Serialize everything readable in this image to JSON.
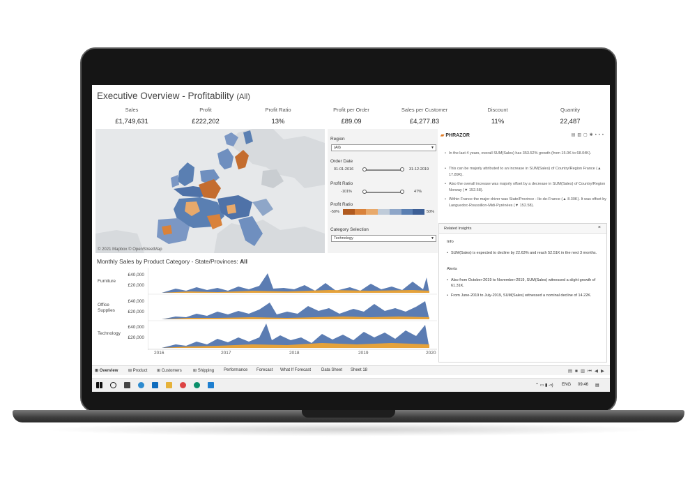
{
  "dashboard": {
    "title": "Executive Overview - Profitability",
    "title_scope": "(All)",
    "kpis": [
      {
        "label": "Sales",
        "value": "£1,749,631"
      },
      {
        "label": "Profit",
        "value": "£222,202"
      },
      {
        "label": "Profit Ratio",
        "value": "13%"
      },
      {
        "label": "Profit per Order",
        "value": "£89.09"
      },
      {
        "label": "Sales per Customer",
        "value": "£4,277.83"
      },
      {
        "label": "Discount",
        "value": "11%"
      },
      {
        "label": "Quantity",
        "value": "22,487"
      }
    ],
    "map_attribution": "© 2021 Mapbox © OpenStreetMap"
  },
  "filters": {
    "region_label": "Region",
    "region_value": "(All)",
    "order_date_label": "Order Date",
    "order_date_start": "01-01-2016",
    "order_date_end": "31-12-2019",
    "profit_ratio_label": "Profit Ratio",
    "profit_ratio_min": "-101%",
    "profit_ratio_max": "47%",
    "profit_ratio_legend_label": "Profit Ratio",
    "legend_min": "-50%",
    "legend_max": "50%",
    "legend_colors": [
      "#b05a1f",
      "#d9823b",
      "#e8a96b",
      "#bfcbd9",
      "#8ea6c8",
      "#5a7fb2",
      "#3d5f96"
    ],
    "category_label": "Category Selection",
    "category_value": "Technology"
  },
  "phrazor": {
    "logo": "PHRAZOR",
    "bullets": [
      "In the last 4 years, overall SUM(Sales) has 353.52% growth (from 15.0K to 68.04K).",
      "This can be majorly attributed to an increase in SUM(Sales) of Country/Region France (▲ 17.89K).",
      "Also the overall increase was majorly offset by a decrease in SUM(Sales) of Country/Region Norway (▼ 152.58).",
      "Within France the major driver was State/Province - Ile-de-France (▲ 8.30K). It was offset by Languedoc-Roussillon-Midi-Pyrénées (▼ 152.58)."
    ],
    "insights_title": "Related Insights",
    "close": "×",
    "info_label": "Info",
    "info_items": [
      "SUM(Sales) is expected to decline by 22.63% and reach 52.51K in the next 3 months."
    ],
    "alerts_label": "Alerts",
    "alert_items": [
      "Also from October-2019 to November-2019, SUM(Sales) witnessed a slight growth of 61.31K.",
      "From June-2019 to July-2019, SUM(Sales) witnessed a nominal decline of 14.22K."
    ]
  },
  "timeseries": {
    "title_prefix": "Monthly Sales by Product Category - State/Provinces:",
    "title_value": "All",
    "rows": [
      {
        "label": "Furniture",
        "ticks": [
          "£40,000",
          "£20,000"
        ]
      },
      {
        "label": "Office Supplies",
        "ticks": [
          "£40,000",
          "£20,000"
        ]
      },
      {
        "label": "Technology",
        "ticks": [
          "£40,000",
          "£20,000"
        ]
      }
    ],
    "years": [
      "2016",
      "2017",
      "2018",
      "2019",
      "2020"
    ],
    "colors": {
      "main": "#5b7cb2",
      "secondary": "#e5a23a"
    }
  },
  "tabs": [
    {
      "label": "Overview",
      "icon": "grid-icon"
    },
    {
      "label": "Product",
      "icon": "grid-icon"
    },
    {
      "label": "Customers",
      "icon": "grid-icon"
    },
    {
      "label": "Shipping",
      "icon": "grid-icon"
    },
    {
      "label": "Performance",
      "icon": ""
    },
    {
      "label": "Forecast",
      "icon": ""
    },
    {
      "label": "What If Forecast",
      "icon": ""
    },
    {
      "label": "Data Sheet",
      "icon": ""
    },
    {
      "label": "Sheet 18",
      "icon": ""
    }
  ],
  "taskbar": {
    "language": "ENG",
    "time": "09:46"
  }
}
